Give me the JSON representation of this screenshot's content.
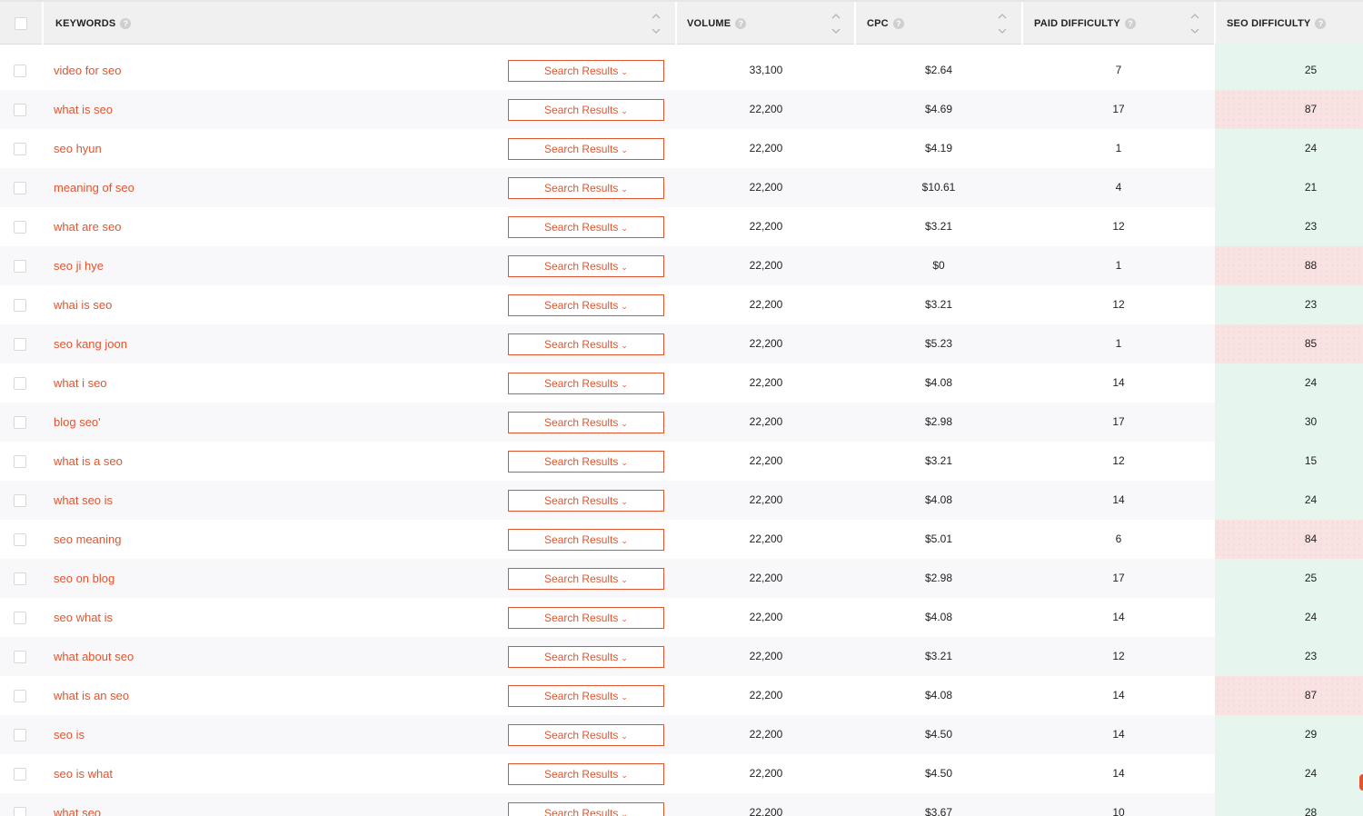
{
  "columns": {
    "keywords": "KEYWORDS",
    "volume": "VOLUME",
    "cpc": "CPC",
    "paid_difficulty": "PAID DIFFICULTY",
    "seo_difficulty": "SEO DIFFICULTY",
    "help_glyph": "?"
  },
  "button_label": "Search Results",
  "colors": {
    "accent": "#e0552f",
    "seo_good_bg": "#e6f6ee",
    "seo_bad_bg": "#f9e2e2"
  },
  "icons": [
    "help-icon",
    "sort-icon",
    "chevron-down-icon",
    "checkbox"
  ],
  "rows": [
    {
      "keyword": "video for seo",
      "volume": "33,100",
      "cpc": "$2.64",
      "paid": "7",
      "seo": "25",
      "seo_level": "good"
    },
    {
      "keyword": "what is seo",
      "volume": "22,200",
      "cpc": "$4.69",
      "paid": "17",
      "seo": "87",
      "seo_level": "bad"
    },
    {
      "keyword": "seo hyun",
      "volume": "22,200",
      "cpc": "$4.19",
      "paid": "1",
      "seo": "24",
      "seo_level": "good"
    },
    {
      "keyword": "meaning of seo",
      "volume": "22,200",
      "cpc": "$10.61",
      "paid": "4",
      "seo": "21",
      "seo_level": "good"
    },
    {
      "keyword": "what are seo",
      "volume": "22,200",
      "cpc": "$3.21",
      "paid": "12",
      "seo": "23",
      "seo_level": "good"
    },
    {
      "keyword": "seo ji hye",
      "volume": "22,200",
      "cpc": "$0",
      "paid": "1",
      "seo": "88",
      "seo_level": "bad"
    },
    {
      "keyword": "whai is seo",
      "volume": "22,200",
      "cpc": "$3.21",
      "paid": "12",
      "seo": "23",
      "seo_level": "good"
    },
    {
      "keyword": "seo kang joon",
      "volume": "22,200",
      "cpc": "$5.23",
      "paid": "1",
      "seo": "85",
      "seo_level": "bad"
    },
    {
      "keyword": "what i seo",
      "volume": "22,200",
      "cpc": "$4.08",
      "paid": "14",
      "seo": "24",
      "seo_level": "good"
    },
    {
      "keyword": "blog seo'",
      "volume": "22,200",
      "cpc": "$2.98",
      "paid": "17",
      "seo": "30",
      "seo_level": "good"
    },
    {
      "keyword": "what is a seo",
      "volume": "22,200",
      "cpc": "$3.21",
      "paid": "12",
      "seo": "15",
      "seo_level": "good"
    },
    {
      "keyword": "what seo is",
      "volume": "22,200",
      "cpc": "$4.08",
      "paid": "14",
      "seo": "24",
      "seo_level": "good"
    },
    {
      "keyword": "seo meaning",
      "volume": "22,200",
      "cpc": "$5.01",
      "paid": "6",
      "seo": "84",
      "seo_level": "bad"
    },
    {
      "keyword": "seo on blog",
      "volume": "22,200",
      "cpc": "$2.98",
      "paid": "17",
      "seo": "25",
      "seo_level": "good"
    },
    {
      "keyword": "seo what is",
      "volume": "22,200",
      "cpc": "$4.08",
      "paid": "14",
      "seo": "24",
      "seo_level": "good"
    },
    {
      "keyword": "what about seo",
      "volume": "22,200",
      "cpc": "$3.21",
      "paid": "12",
      "seo": "23",
      "seo_level": "good"
    },
    {
      "keyword": "what is an seo",
      "volume": "22,200",
      "cpc": "$4.08",
      "paid": "14",
      "seo": "87",
      "seo_level": "bad"
    },
    {
      "keyword": "seo is",
      "volume": "22,200",
      "cpc": "$4.50",
      "paid": "14",
      "seo": "29",
      "seo_level": "good"
    },
    {
      "keyword": "seo is what",
      "volume": "22,200",
      "cpc": "$4.50",
      "paid": "14",
      "seo": "24",
      "seo_level": "good"
    },
    {
      "keyword": "what seo",
      "volume": "22,200",
      "cpc": "$3.67",
      "paid": "10",
      "seo": "28",
      "seo_level": "good"
    }
  ]
}
